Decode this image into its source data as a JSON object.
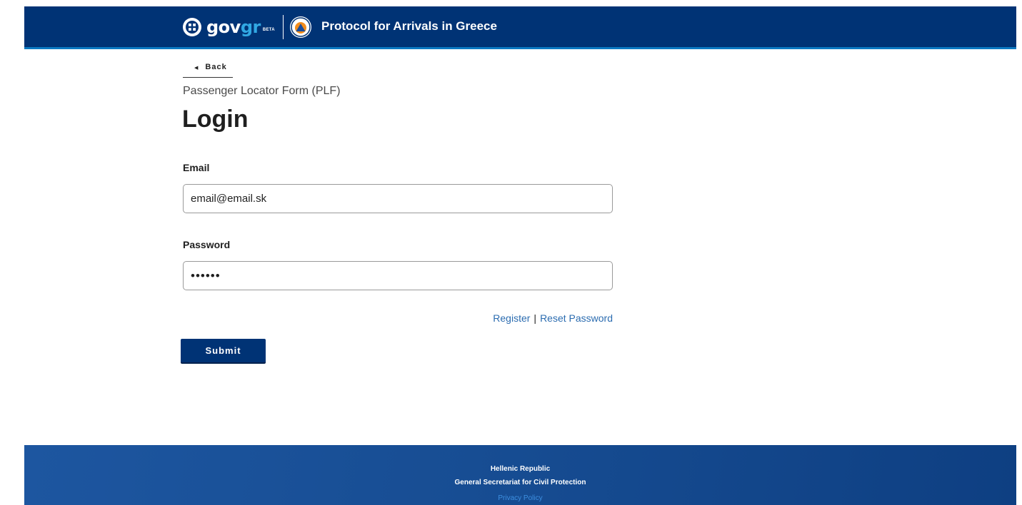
{
  "header": {
    "logo_text_gov": "gov",
    "logo_text_gr": "gr",
    "logo_badge": "BETA",
    "site_title": "Protocol for Arrivals in Greece",
    "colors": {
      "background": "#003375",
      "accent": "#31a8e3"
    },
    "icons": [
      "greek-emblem-icon",
      "civil-protection-icon"
    ]
  },
  "main": {
    "back_label": "Back",
    "subtitle": "Passenger Locator Form (PLF)",
    "title": "Login",
    "email": {
      "label": "Email",
      "value": "email@email.sk"
    },
    "password": {
      "label": "Password",
      "value": "••••••"
    },
    "register_label": "Register",
    "separator": "|",
    "reset_password_label": "Reset Password",
    "submit_label": "Submit"
  },
  "footer": {
    "line1": "Hellenic Republic",
    "line2": "General Secretariat for Civil Protection",
    "privacy_label": "Privacy Policy"
  }
}
